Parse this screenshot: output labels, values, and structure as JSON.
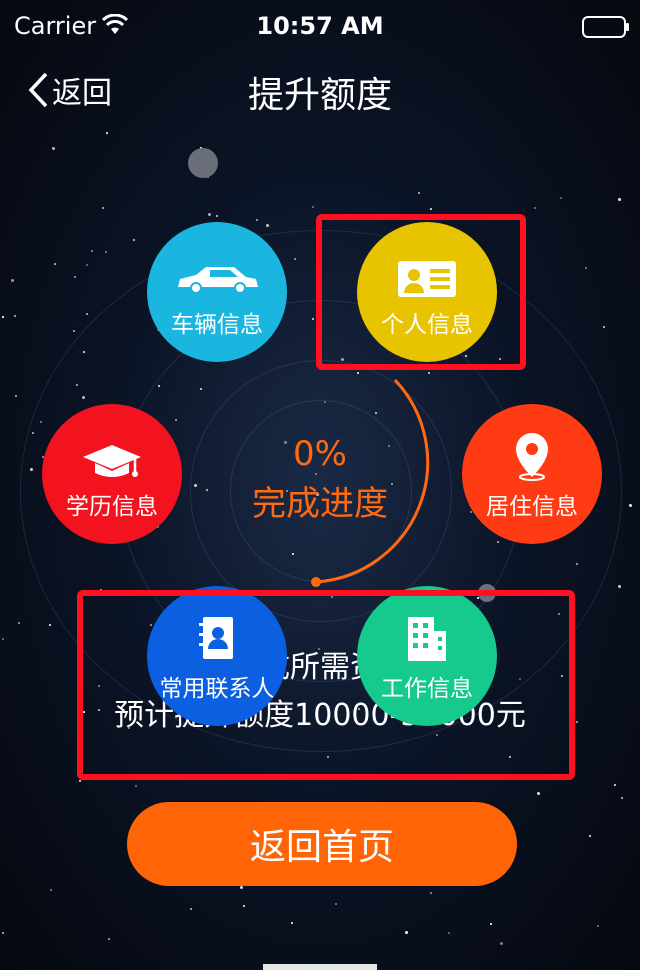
{
  "status_bar": {
    "carrier": "Carrier",
    "time": "10:57 AM"
  },
  "nav": {
    "back_label": "返回",
    "title": "提升额度"
  },
  "progress": {
    "percent": "0%",
    "label": "完成进度",
    "value": 0
  },
  "items": [
    {
      "label": "车辆信息",
      "icon": "car-icon",
      "color": "#1ab6e0"
    },
    {
      "label": "个人信息",
      "icon": "id-card-icon",
      "color": "#e8c400"
    },
    {
      "label": "学历信息",
      "icon": "graduation-cap-icon",
      "color": "#f3131f"
    },
    {
      "label": "居住信息",
      "icon": "location-pin-icon",
      "color": "#ff3b14"
    },
    {
      "label": "常用联系人",
      "icon": "contact-book-icon",
      "color": "#0b5fe0"
    },
    {
      "label": "工作信息",
      "icon": "building-icon",
      "color": "#16c98c"
    }
  ],
  "summary": {
    "line1": "完成所需资料",
    "line2": "预计提升额度10000-50000元"
  },
  "home_button": "返回首页"
}
